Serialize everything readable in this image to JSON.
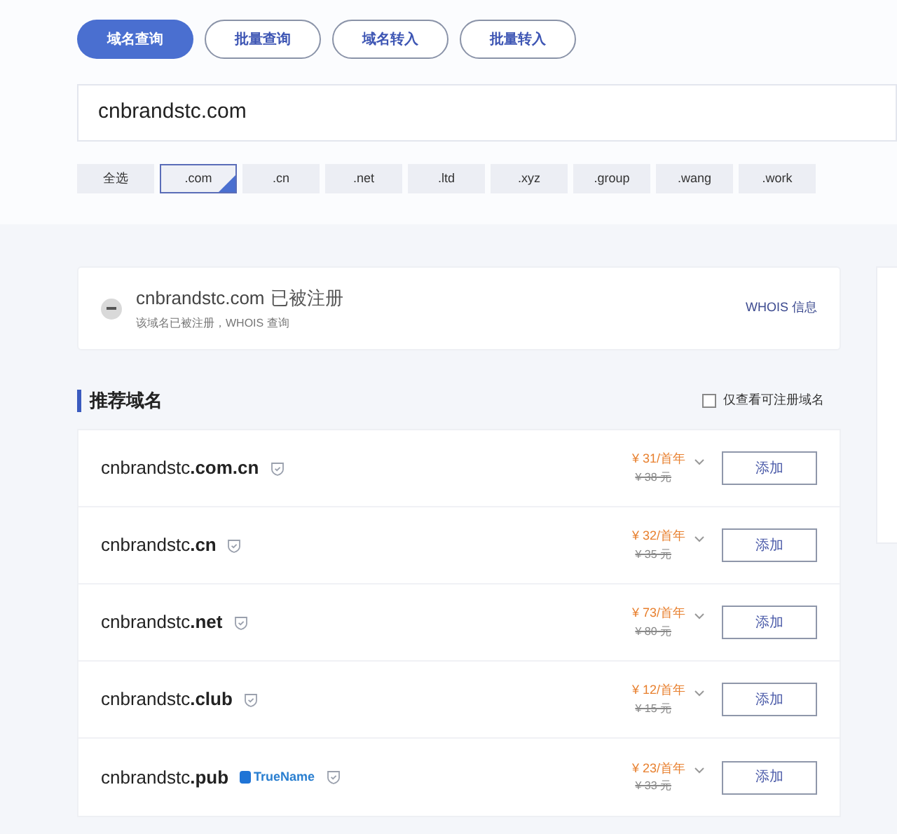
{
  "tabs": [
    {
      "label": "域名查询",
      "selected": true
    },
    {
      "label": "批量查询",
      "selected": false
    },
    {
      "label": "域名转入",
      "selected": false
    },
    {
      "label": "批量转入",
      "selected": false
    }
  ],
  "search": {
    "value": "cnbrandstc.com"
  },
  "tlds": [
    {
      "label": "全选",
      "selected": false
    },
    {
      "label": ".com",
      "selected": true
    },
    {
      "label": ".cn",
      "selected": false
    },
    {
      "label": ".net",
      "selected": false
    },
    {
      "label": ".ltd",
      "selected": false
    },
    {
      "label": ".xyz",
      "selected": false
    },
    {
      "label": ".group",
      "selected": false
    },
    {
      "label": ".wang",
      "selected": false
    },
    {
      "label": ".work",
      "selected": false
    }
  ],
  "result": {
    "domain": "cnbrandstc.com",
    "status": "已被注册",
    "note": "该域名已被注册，WHOIS 查询",
    "link": "WHOIS 信息"
  },
  "recommend": {
    "title": "推荐域名",
    "filter": {
      "label": "仅查看可注册域名",
      "checked": false
    },
    "rows": [
      {
        "domain": "cnbrandstc**.com.cn**",
        "price": "¥ 31/首年",
        "old_price": "¥ 38 元",
        "button": "添加"
      },
      {
        "domain": "cnbrandstc**.cn**",
        "price": "¥ 32/首年",
        "old_price": "¥ 35 元",
        "button": "添加"
      },
      {
        "domain": "cnbrandstc**.net**",
        "price": "¥ 73/首年",
        "old_price": "¥ 80 元",
        "button": "添加"
      },
      {
        "domain": "cnbrandstc**.club**",
        "price": "¥ 12/首年",
        "old_price": "¥ 15 元",
        "button": "添加"
      },
      {
        "domain": "cnbrandstc**.pub**",
        "badge": "TrueName",
        "price": "¥ 23/首年",
        "old_price": "¥ 33 元",
        "button": "添加"
      }
    ]
  }
}
